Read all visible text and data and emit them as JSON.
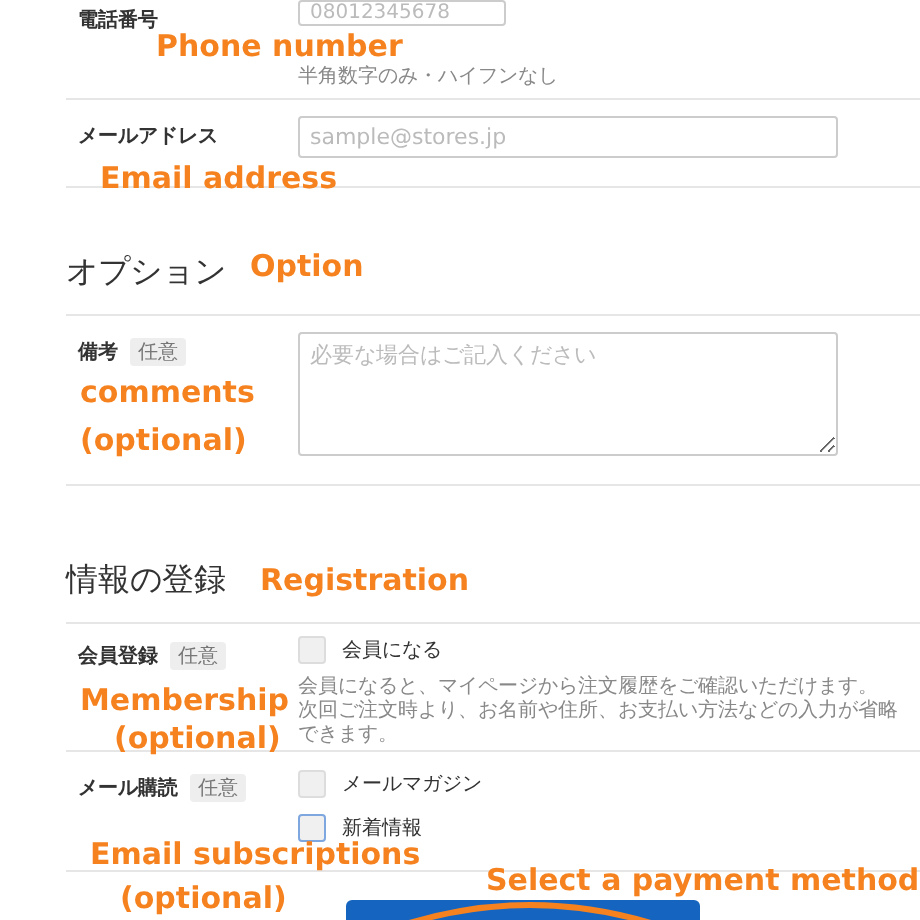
{
  "contact": [
    {
      "kind": "text",
      "label": "電話番号",
      "placeholder": "08012345678",
      "hint": "半角数字のみ・ハイフンなし"
    },
    {
      "kind": "text",
      "label": "メールアドレス",
      "placeholder": "sample@stores.jp"
    }
  ],
  "sections": [
    {
      "heading": "オプション",
      "fields": [
        {
          "kind": "textarea",
          "label": "備考",
          "badge": "任意",
          "placeholder": "必要な場合はご記入ください"
        }
      ]
    },
    {
      "heading": "情報の登録",
      "fields": [
        {
          "kind": "checks",
          "label": "会員登録",
          "badge": "任意",
          "options": [
            {
              "label": "会員になる",
              "checked": false,
              "focused": false
            }
          ],
          "notes": [
            "会員になると、マイページから注文履歴をご確認いただけます。",
            "次回ご注文時より、お名前や住所、お支払い方法などの入力が省略できます。"
          ]
        },
        {
          "kind": "checks",
          "label": "メール購読",
          "badge": "任意",
          "options": [
            {
              "label": "メールマガジン",
              "checked": false,
              "focused": false
            },
            {
              "label": "新着情報",
              "checked": false,
              "focused": true
            }
          ]
        }
      ]
    }
  ],
  "annotations": [
    {
      "text": "Phone number"
    },
    {
      "text": "Email address"
    },
    {
      "text": "Option"
    },
    {
      "text": "comments"
    },
    {
      "text": "(optional)"
    },
    {
      "text": "Registration"
    },
    {
      "text": "Membership"
    },
    {
      "text": "(optional)"
    },
    {
      "text": "Email subscriptions"
    },
    {
      "text": "(optional)"
    },
    {
      "text": "Select a payment method"
    }
  ]
}
